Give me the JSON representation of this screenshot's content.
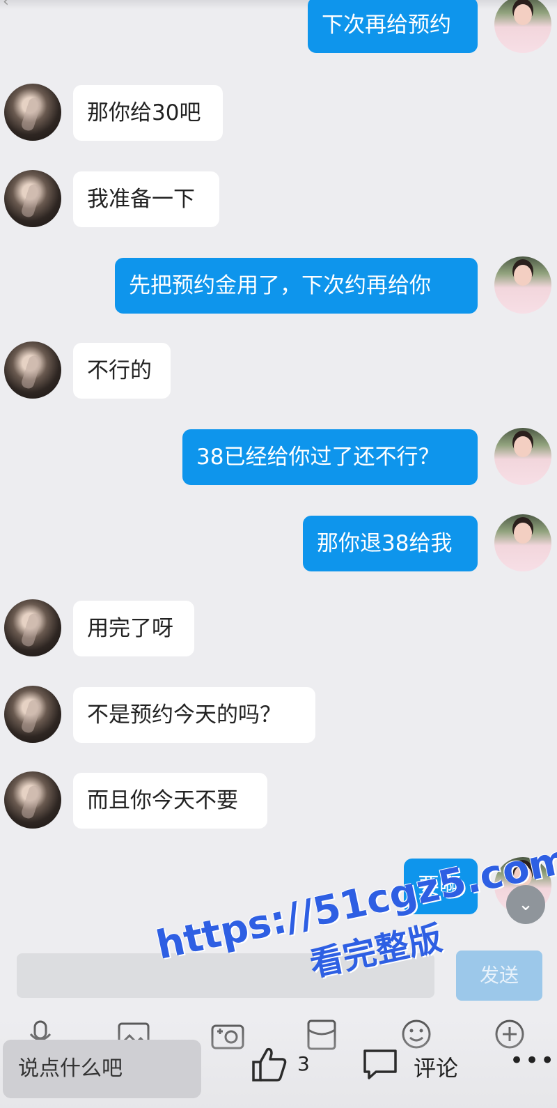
{
  "messages": [
    {
      "side": "right",
      "text": "下次再给预约"
    },
    {
      "side": "left",
      "text": "那你给30吧"
    },
    {
      "side": "left",
      "text": "我准备一下"
    },
    {
      "side": "right",
      "text": "先把预约金用了，下次约再给你"
    },
    {
      "side": "left",
      "text": "不行的"
    },
    {
      "side": "right",
      "text": "38已经给你过了还不行？"
    },
    {
      "side": "right",
      "text": "那你退38给我"
    },
    {
      "side": "left",
      "text": "用完了呀"
    },
    {
      "side": "left",
      "text": "不是预约今天的吗？"
    },
    {
      "side": "left",
      "text": "而且你今天不要"
    },
    {
      "side": "right",
      "text": "要啊"
    }
  ],
  "input": {
    "value": "",
    "send_label": "发送"
  },
  "bottom_bar": {
    "comment_placeholder": "说点什么吧",
    "like_count": "3",
    "comment_label": "评论"
  },
  "watermark": {
    "url": "https://51cgz5.com",
    "subtitle": "看完整版",
    "color": "#2e5fe3"
  },
  "colors": {
    "outgoing_bubble": "#0e95ec",
    "incoming_bubble": "#ffffff",
    "background": "#ededf0"
  }
}
